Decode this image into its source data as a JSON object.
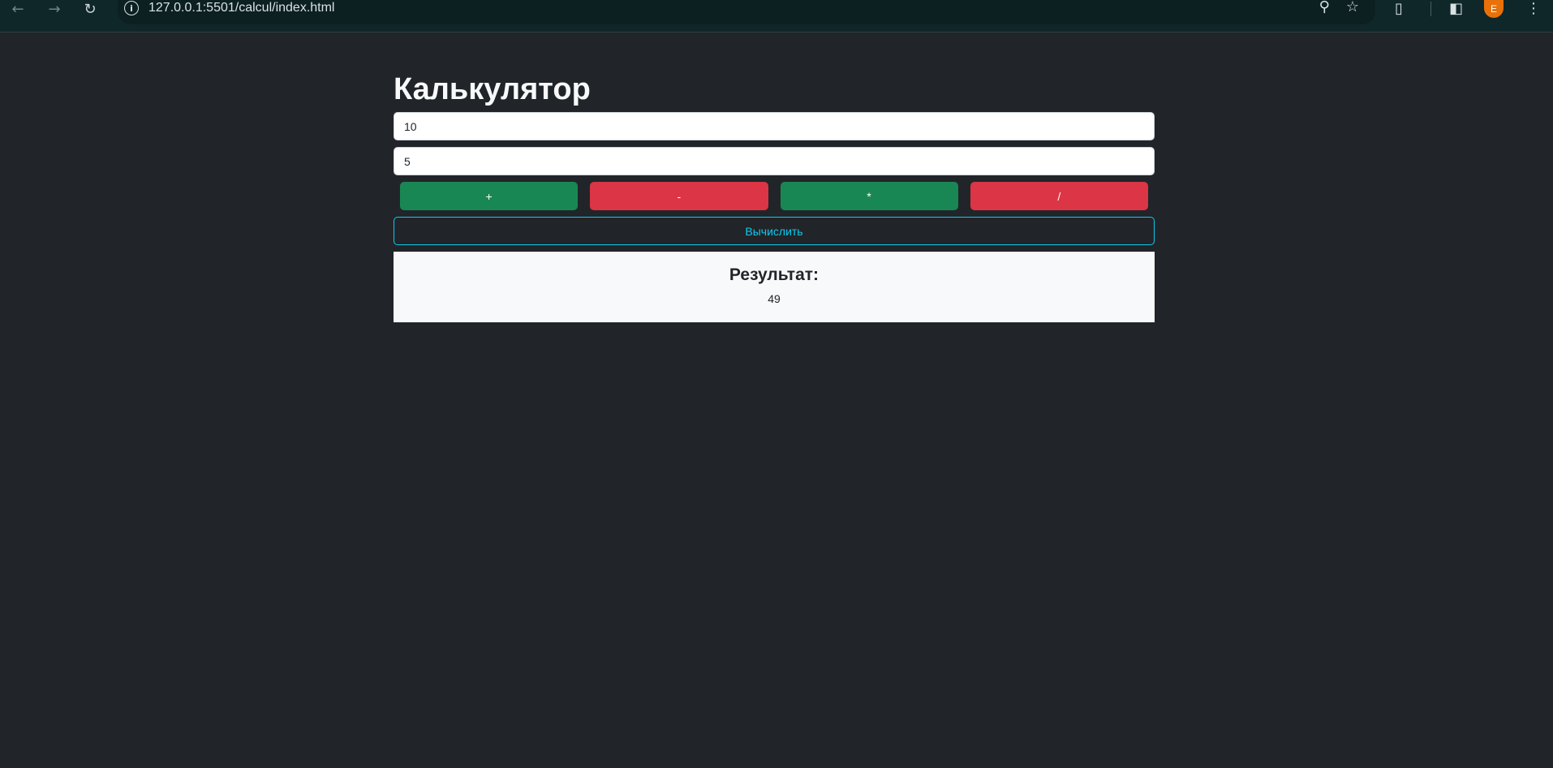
{
  "browser": {
    "url": "127.0.0.1:5501/calcul/index.html",
    "profile_initial": "E",
    "icons": {
      "back": "arrow-left-icon",
      "forward": "arrow-right-icon",
      "reload": "reload-icon",
      "site_info": "info-icon",
      "zoom": "zoom-icon",
      "bookmark": "star-icon",
      "extensions": "puzzle-icon",
      "side_panel": "side-panel-icon",
      "menu": "kebab-menu-icon"
    }
  },
  "page": {
    "title": "Калькулятор",
    "input1_value": "10",
    "input2_value": "5",
    "operations": [
      {
        "label": "+",
        "color": "#198754"
      },
      {
        "label": "-",
        "color": "#dc3545"
      },
      {
        "label": "*",
        "color": "#198754"
      },
      {
        "label": "/",
        "color": "#dc3545"
      }
    ],
    "calculate_label": "Вычислить",
    "result_title": "Результат:",
    "result_value": "49"
  },
  "colors": {
    "background": "#212529",
    "success": "#198754",
    "danger": "#dc3545",
    "info": "#0dcaf0",
    "result_bg": "#f8f9fa"
  }
}
